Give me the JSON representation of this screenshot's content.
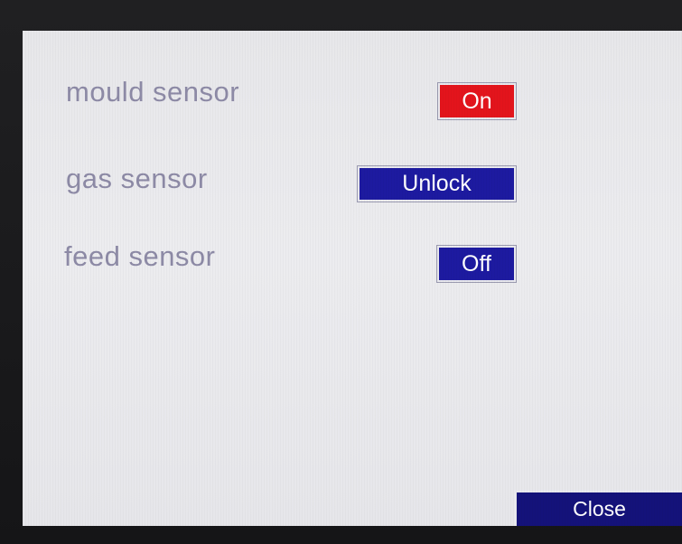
{
  "sensors": [
    {
      "label": "mould sensor",
      "state": "On",
      "state_color": "#e3141c"
    },
    {
      "label": "gas sensor",
      "state": "Unlock",
      "state_color": "#1d1aa0"
    },
    {
      "label": "feed sensor",
      "state": "Off",
      "state_color": "#1d1aa0"
    }
  ],
  "footer": {
    "close_label": "Close",
    "close_color": "#14127a"
  },
  "colors": {
    "screen_background": "#ececef",
    "label_text": "#8d8aa6",
    "bezel": "#1b1b1d"
  }
}
